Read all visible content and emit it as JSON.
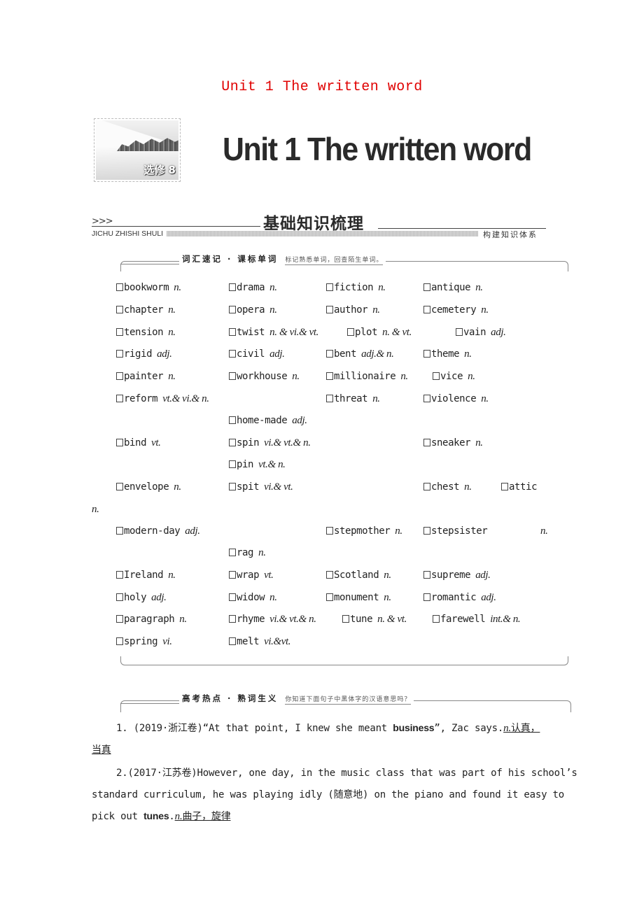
{
  "page_title": "Unit 1 The written word",
  "banner": {
    "thumbnail_label": "选修 8",
    "title": "Unit 1  The written word"
  },
  "section": {
    "chevrons": ">>>",
    "title": "基础知识梳理",
    "pinyin": "JICHU ZHISHI SHULI",
    "subtitle": "构建知识体系"
  },
  "vocab_box": {
    "label": "词汇速记 · 课标单词",
    "hint": "标记熟悉单词，回查陌生单词。",
    "rows": [
      [
        {
          "word": "bookworm",
          "pos": "n."
        },
        {
          "word": "drama",
          "pos": "n."
        },
        {
          "word": "fiction",
          "pos": "n."
        },
        {
          "word": "antique",
          "pos": "n."
        }
      ],
      [
        {
          "word": "chapter",
          "pos": "n."
        },
        {
          "word": "opera",
          "pos": "n."
        },
        {
          "word": "author",
          "pos": "n."
        },
        {
          "word": "cemetery",
          "pos": "n."
        }
      ],
      [
        {
          "word": "tension",
          "pos": "n."
        },
        {
          "word": "twist",
          "pos": "n. & vi.& vt."
        },
        {
          "word": "plot",
          "pos": "n. & vt."
        },
        {
          "word": "vain",
          "pos": "adj."
        }
      ],
      [
        {
          "word": "rigid",
          "pos": "adj."
        },
        {
          "word": "civil",
          "pos": "adj."
        },
        {
          "word": "bent",
          "pos": "adj.& n."
        },
        {
          "word": "theme",
          "pos": "n."
        }
      ],
      [
        {
          "word": "painter",
          "pos": "n."
        },
        {
          "word": "workhouse",
          "pos": "n."
        },
        {
          "word": "millionaire",
          "pos": "n."
        },
        {
          "word": "vice",
          "pos": "n."
        }
      ],
      [
        {
          "word": "reform",
          "pos": "vt.& vi.& n."
        },
        {
          "word": "threat",
          "pos": "n."
        },
        {
          "word": "violence",
          "pos": "n."
        }
      ],
      [
        {
          "word": "home-made",
          "pos": "adj."
        }
      ],
      [
        {
          "word": "bind",
          "pos": "vt."
        },
        {
          "word": "spin",
          "pos": "vi.& vt.& n."
        },
        {
          "word": "sneaker",
          "pos": "n."
        }
      ],
      [
        {
          "word": "pin",
          "pos": "vt.& n."
        }
      ],
      [
        {
          "word": "envelope",
          "pos": "n."
        },
        {
          "word": "spit",
          "pos": "vi.& vt."
        },
        {
          "word": "chest",
          "pos": "n."
        },
        {
          "word": "attic",
          "pos": ""
        }
      ],
      [
        {
          "word": "",
          "pos": "n."
        }
      ],
      [
        {
          "word": "modern-day",
          "pos": "adj."
        },
        {
          "word": "stepmother",
          "pos": "n."
        },
        {
          "word": "stepsister",
          "pos": ""
        },
        {
          "word": "",
          "pos": "n."
        }
      ],
      [
        {
          "word": "rag",
          "pos": "n."
        }
      ],
      [
        {
          "word": "Ireland",
          "pos": "n."
        },
        {
          "word": "wrap",
          "pos": "vt."
        },
        {
          "word": "Scotland",
          "pos": "n."
        },
        {
          "word": "supreme",
          "pos": "adj."
        }
      ],
      [
        {
          "word": "holy",
          "pos": "adj."
        },
        {
          "word": "widow",
          "pos": "n."
        },
        {
          "word": "monument",
          "pos": "n."
        },
        {
          "word": "romantic",
          "pos": "adj."
        }
      ],
      [
        {
          "word": "paragraph",
          "pos": "n."
        },
        {
          "word": "rhyme",
          "pos": "vi.& vt.& n."
        },
        {
          "word": "tune",
          "pos": "n. & vt."
        },
        {
          "word": "farewell",
          "pos": "int.& n."
        }
      ],
      [
        {
          "word": "spring",
          "pos": "vi."
        },
        {
          "word": "melt",
          "pos": "vi.&vt."
        }
      ]
    ]
  },
  "hot_box": {
    "label": "高考热点 · 熟词生义",
    "hint": "你知道下面句子中黑体字的汉语意思吗？"
  },
  "examples": [
    {
      "number": "1.",
      "source": "(2019·浙江卷)",
      "text_before": "“At that point, I knew she meant ",
      "keyword": "business",
      "text_after": "”, Zac says.",
      "answer_pos": "n.",
      "answer_line1": "认真，",
      "answer_line2": "当真"
    },
    {
      "number": "2.",
      "source": "(2017·江苏卷)",
      "line1": "However, one day, in the music class that was part of his school’s",
      "line2": "standard curriculum, he was playing idly (随意地) on the piano and found it easy to",
      "line3_before": "pick out ",
      "keyword": "tunes",
      "line3_after": ".",
      "answer_pos": "n.",
      "answer": "曲子，旋律"
    }
  ]
}
